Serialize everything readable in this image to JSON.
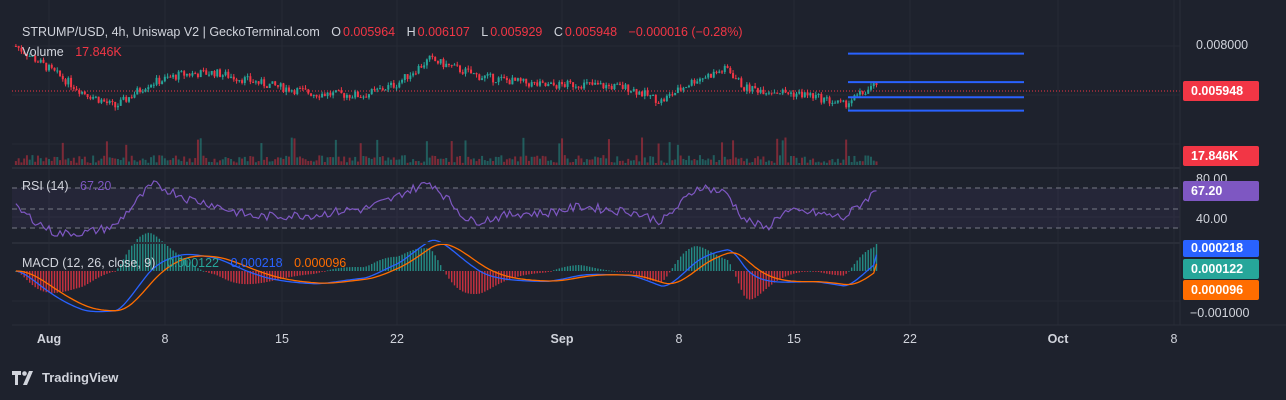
{
  "header": {
    "symbol": "STRUMP/USD, 4h, Uniswap V2 | GeckoTerminal.com",
    "o_label": "O",
    "o_value": "0.005964",
    "h_label": "H",
    "h_value": "0.006107",
    "l_label": "L",
    "l_value": "0.005929",
    "c_label": "C",
    "c_value": "0.005948",
    "change": "−0.000016 (−0.28%)",
    "volume_label": "Volume",
    "volume_value": "17.846K"
  },
  "rsi": {
    "label": "RSI (14)",
    "value": "67.20"
  },
  "macd": {
    "label": "MACD (12, 26, close, 9)",
    "hist": "0.000122",
    "macd": "0.000218",
    "signal": "0.000096"
  },
  "price_axis": [
    "0.008000",
    "80.00",
    "40.00",
    "−0.001000"
  ],
  "badges": {
    "price": "0.005948",
    "volume": "17.846K",
    "rsi": "67.20",
    "macd": "0.000218",
    "hist": "0.000122",
    "signal": "0.000096"
  },
  "time_axis": [
    "Aug",
    "8",
    "15",
    "22",
    "Sep",
    "8",
    "15",
    "22",
    "Oct",
    "8"
  ],
  "branding": {
    "text": "TradingView"
  },
  "colors": {
    "up": "#26a69a",
    "down": "#f23645",
    "rsi": "#7e57c2",
    "macd": "#2962ff",
    "signal": "#ff6d00",
    "level": "#2962ff"
  },
  "chart_data": {
    "type": "candlestick",
    "symbol": "STRUMP/USD",
    "interval": "4h",
    "last_close": 0.005948,
    "horizontal_levels": [
      0.0076,
      0.0061,
      0.0053,
      0.0046
    ],
    "price_anchors": [
      {
        "t": "Jul 30",
        "p": 0.008
      },
      {
        "t": "Aug 3",
        "p": 0.0056
      },
      {
        "t": "Aug 5",
        "p": 0.0048
      },
      {
        "t": "Aug 7",
        "p": 0.006
      },
      {
        "t": "Aug 9",
        "p": 0.0065
      },
      {
        "t": "Aug 11",
        "p": 0.0066
      },
      {
        "t": "Aug 14",
        "p": 0.006
      },
      {
        "t": "Aug 17",
        "p": 0.0055
      },
      {
        "t": "Aug 20",
        "p": 0.0054
      },
      {
        "t": "Aug 22",
        "p": 0.006
      },
      {
        "t": "Aug 24",
        "p": 0.0073
      },
      {
        "t": "Aug 27",
        "p": 0.0064
      },
      {
        "t": "Aug 31",
        "p": 0.0059
      },
      {
        "t": "Sep 2",
        "p": 0.006
      },
      {
        "t": "Sep 5",
        "p": 0.0058
      },
      {
        "t": "Sep 7",
        "p": 0.0051
      },
      {
        "t": "Sep 9",
        "p": 0.0062
      },
      {
        "t": "Sep 11",
        "p": 0.0068
      },
      {
        "t": "Sep 12",
        "p": 0.0058
      },
      {
        "t": "Sep 16",
        "p": 0.0054
      },
      {
        "t": "Sep 18",
        "p": 0.0049
      },
      {
        "t": "Sep 20",
        "p": 0.005948
      }
    ],
    "rsi_levels": [
      70,
      50,
      30
    ],
    "rsi_last": 67.2,
    "macd_last": 0.000218,
    "signal_last": 9.6e-05,
    "hist_last": 0.000122
  }
}
